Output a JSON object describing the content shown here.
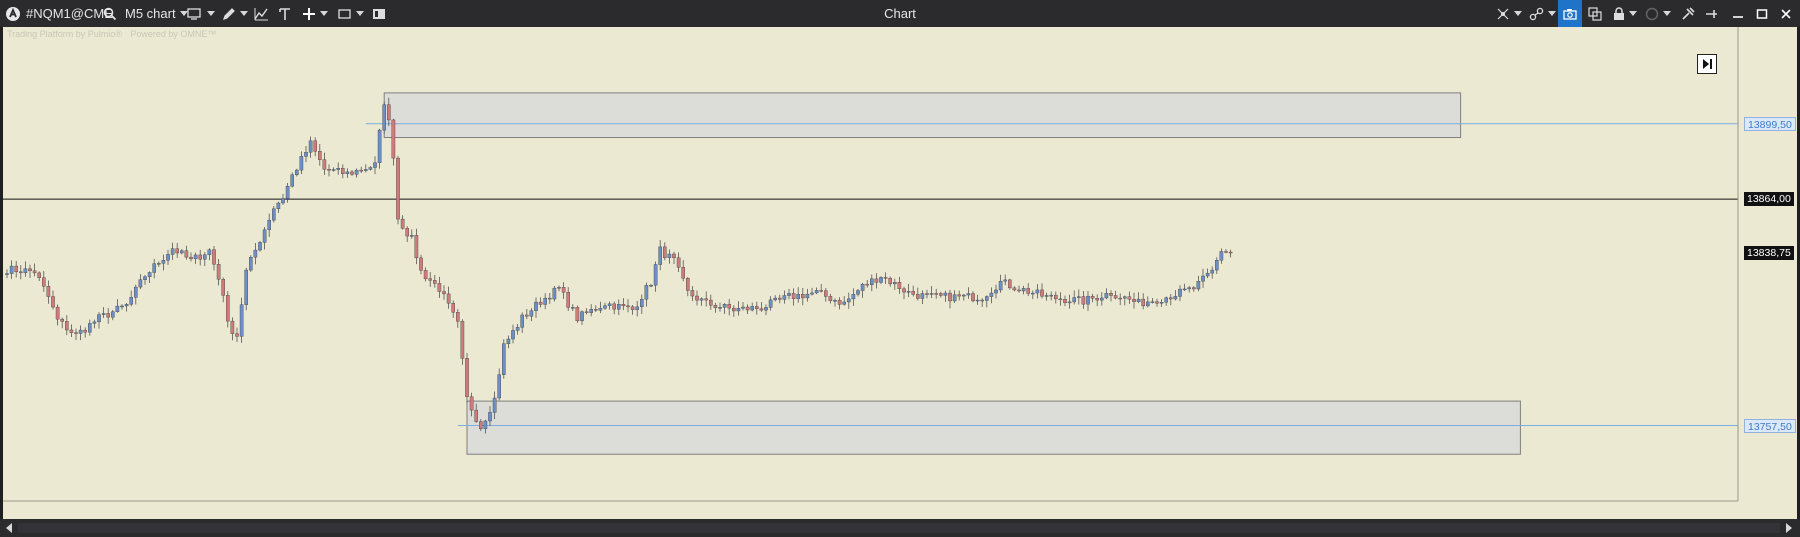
{
  "window": {
    "symbol": "#NQM1@CME",
    "timeframe_label": "M5 chart",
    "title": "Chart"
  },
  "watermark": {
    "text1": "Trading Platform by Pulmio®",
    "text2": "Powered by OMNE™"
  },
  "colors": {
    "chart_background": "#ece9d3",
    "bull_candle": "#6d8fc7",
    "bear_candle": "#d17a7a",
    "zone_fill": "#d9d9d9",
    "level_line": "#7aaee0",
    "current_line": "#111111"
  },
  "icons": [
    "app-logo-icon",
    "search-icon",
    "monitor-icon",
    "pencil-icon",
    "indicator-icon",
    "text-tool-icon",
    "crosshair-icon",
    "window-icon",
    "layout-icon",
    "sync-icon",
    "link-icon",
    "camera-icon",
    "copy-window-icon",
    "lock-icon",
    "circle-icon",
    "tools-icon",
    "pin-icon",
    "minimize-icon",
    "maximize-icon",
    "close-icon",
    "scroll-to-end-icon"
  ],
  "price_labels": {
    "upper_level": "13899,50",
    "current_price": "13864,00",
    "last_price": "13838,75",
    "lower_level": "13757,50"
  },
  "chart_data": {
    "type": "candlestick",
    "symbol": "#NQM1@CME",
    "timeframe": "M5",
    "y_range": [
      13722,
      13945
    ],
    "levels": [
      {
        "name": "upper_level",
        "price": 13899.5
      },
      {
        "name": "current_price",
        "price": 13864.0
      },
      {
        "name": "last_price",
        "price": 13838.75
      },
      {
        "name": "lower_level",
        "price": 13757.5
      }
    ],
    "zones": [
      {
        "from_bar": 82,
        "to_bar": 316,
        "top": 13914,
        "bottom": 13893
      },
      {
        "from_bar": 100,
        "to_bar": 329,
        "top": 13769,
        "bottom": 13744
      }
    ],
    "anchors": [
      [
        0,
        13831
      ],
      [
        6,
        13830
      ],
      [
        9,
        13818
      ],
      [
        11,
        13807
      ],
      [
        15,
        13800
      ],
      [
        20,
        13808
      ],
      [
        26,
        13814
      ],
      [
        30,
        13828
      ],
      [
        36,
        13841
      ],
      [
        40,
        13835
      ],
      [
        44,
        13840
      ],
      [
        47,
        13820
      ],
      [
        48,
        13805
      ],
      [
        50,
        13800
      ],
      [
        52,
        13830
      ],
      [
        55,
        13845
      ],
      [
        58,
        13860
      ],
      [
        60,
        13865
      ],
      [
        62,
        13875
      ],
      [
        66,
        13890
      ],
      [
        69,
        13878
      ],
      [
        74,
        13876
      ],
      [
        80,
        13880
      ],
      [
        82,
        13910
      ],
      [
        83,
        13900
      ],
      [
        84,
        13885
      ],
      [
        85,
        13855
      ],
      [
        88,
        13845
      ],
      [
        90,
        13830
      ],
      [
        94,
        13822
      ],
      [
        98,
        13805
      ],
      [
        100,
        13770
      ],
      [
        103,
        13757
      ],
      [
        106,
        13770
      ],
      [
        108,
        13795
      ],
      [
        112,
        13808
      ],
      [
        116,
        13816
      ],
      [
        120,
        13822
      ],
      [
        124,
        13808
      ],
      [
        130,
        13815
      ],
      [
        136,
        13812
      ],
      [
        140,
        13825
      ],
      [
        142,
        13840
      ],
      [
        145,
        13835
      ],
      [
        148,
        13820
      ],
      [
        152,
        13815
      ],
      [
        158,
        13812
      ],
      [
        164,
        13813
      ],
      [
        170,
        13818
      ],
      [
        176,
        13820
      ],
      [
        182,
        13815
      ],
      [
        186,
        13823
      ],
      [
        190,
        13828
      ],
      [
        196,
        13820
      ],
      [
        200,
        13818
      ],
      [
        206,
        13818
      ],
      [
        212,
        13818
      ],
      [
        216,
        13825
      ],
      [
        220,
        13822
      ],
      [
        226,
        13818
      ],
      [
        234,
        13816
      ],
      [
        240,
        13820
      ],
      [
        246,
        13815
      ],
      [
        252,
        13818
      ],
      [
        258,
        13822
      ],
      [
        262,
        13830
      ],
      [
        264,
        13840
      ],
      [
        266,
        13839
      ]
    ]
  }
}
